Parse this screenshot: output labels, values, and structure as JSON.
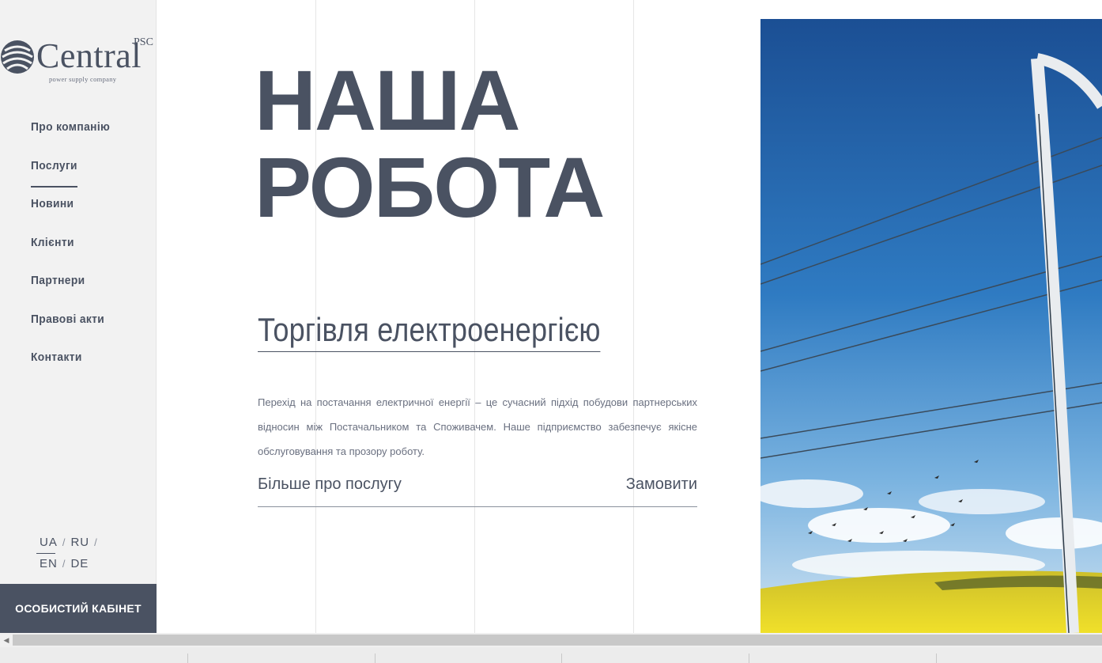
{
  "logo": {
    "brand": "Central",
    "superscript": "PSC",
    "tagline": "power supply company"
  },
  "nav": {
    "items": [
      "Про компанію",
      "Послуги",
      "Новини",
      "Клієнти",
      "Партнери",
      "Правові акти",
      "Контакти"
    ]
  },
  "languages": {
    "row1": [
      "UA",
      "RU"
    ],
    "row2": [
      "EN",
      "DE"
    ],
    "active": "UA"
  },
  "cabinet_button": "ОСОБИСТИЙ КАБІНЕТ",
  "hero": {
    "line1": "НАША",
    "line2": "РОБОТА"
  },
  "service": {
    "title": "Торгівля електроенергією",
    "description": "Перехід на постачання електричної енергії – це сучасний підхід побудови партнерських відносин між Постачальником та Споживачем. Наше підприємство забезпечує якісне обслуговування та прозору роботу.",
    "more_link": "Більше про послугу",
    "order_link": "Замовити"
  },
  "colors": {
    "text": "#4a5262",
    "sidebar_bg": "#f2f2f2",
    "cabinet_bg": "#4a5262",
    "sky": "#1d5fa6",
    "field": "#e8d82a"
  }
}
